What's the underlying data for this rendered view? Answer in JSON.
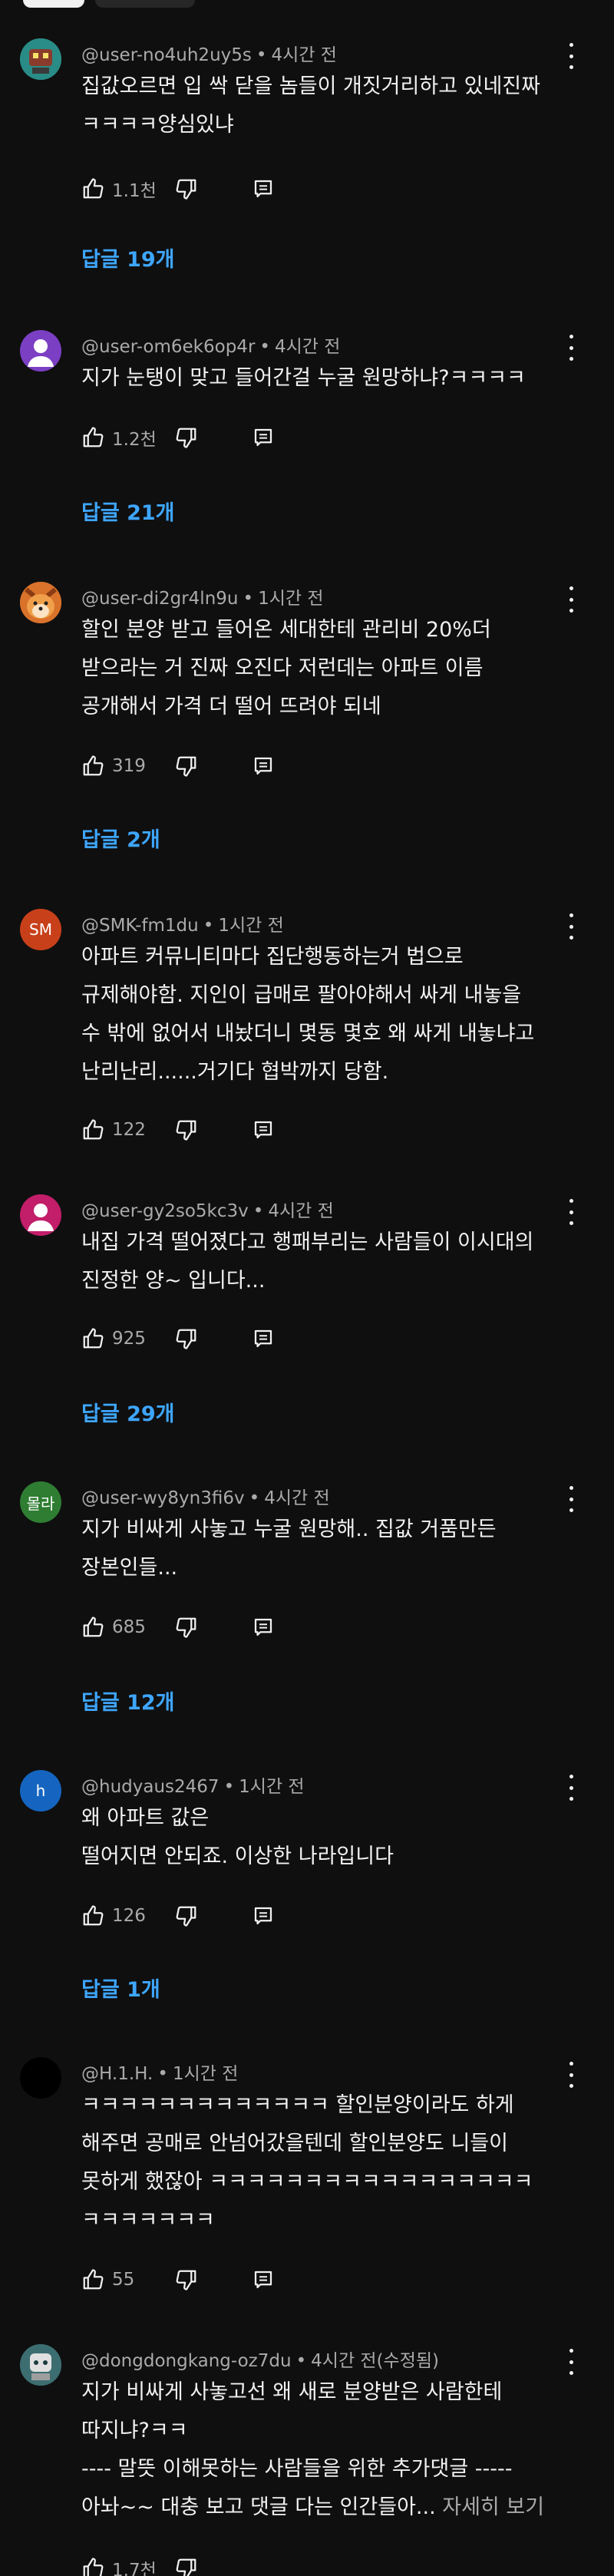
{
  "comments": [
    {
      "handle": "@user-no4uh2uy5s",
      "time": "4시간 전",
      "avatar": "",
      "text": "집값오르면 입 싹 닫을 놈들이 개짓거리하고 있네진짜\nㅋㅋㅋㅋ양심있냐",
      "more": "",
      "likes": "1.1천",
      "replies": "답글 19개",
      "colors": {
        "avatar_bg": "#2a8c86"
      }
    },
    {
      "handle": "@user-om6ek6op4r",
      "time": "4시간 전",
      "avatar": "",
      "text": "지가 눈탱이 맞고 들어간걸 누굴 원망하냐?ㅋㅋㅋㅋ",
      "more": "",
      "likes": "1.2천",
      "replies": "답글 21개",
      "colors": {
        "avatar_bg": "#7b3fc4"
      }
    },
    {
      "handle": "@user-di2gr4ln9u",
      "time": "1시간 전",
      "avatar": "",
      "text": "할인 분양 받고 들어온 세대한테 관리비 20%더\n받으라는 거  진짜 오진다    저런데는 아파트 이름\n공개해서 가격 더 떨어 뜨려야 되네",
      "more": "",
      "likes": "319",
      "replies": "답글 2개",
      "colors": {
        "avatar_bg": "#d9722b"
      }
    },
    {
      "handle": "@SMK-fm1du",
      "time": "1시간 전",
      "avatar": "SM",
      "text": "아파트 커뮤니티마다 집단행동하는거 법으로\n규제해야함. 지인이 급매로 팔아야해서 싸게 내놓을\n수 밖에 없어서 내놨더니 몇동 몇호 왜 싸게 내놓냐고\n난리난리......거기다 협박까지 당함.",
      "more": "",
      "likes": "122",
      "replies": "",
      "colors": {
        "avatar_bg": "#c8401a"
      }
    },
    {
      "handle": "@user-gy2so5kc3v",
      "time": "4시간 전",
      "avatar": "",
      "text": "내집 가격 떨어졌다고 행패부리는 사람들이 이시대의\n진정한 양~ 입니다...",
      "more": "",
      "likes": "925",
      "replies": "답글 29개",
      "colors": {
        "avatar_bg": "#c21e6a"
      }
    },
    {
      "handle": "@user-wy8yn3fi6v",
      "time": "4시간 전",
      "avatar": "몰라",
      "text": "지가 비싸게 사놓고 누굴 원망해.. 집값 거품만든\n장본인들...",
      "more": "",
      "likes": "685",
      "replies": "답글 12개",
      "colors": {
        "avatar_bg": "#2e7d32"
      }
    },
    {
      "handle": "@hudyaus2467",
      "time": "1시간 전",
      "avatar": "h",
      "text": "왜 아파트 값은\n떨어지면 안되죠.  이상한 나라입니다",
      "more": "",
      "likes": "126",
      "replies": "답글 1개",
      "colors": {
        "avatar_bg": "#1565c0"
      }
    },
    {
      "handle": "@H.1.H.",
      "time": "1시간 전",
      "avatar": "",
      "text": "ㅋㅋㅋㅋㅋㅋㅋㅋㅋㅋㅋㅋㅋ 할인분양이라도 하게\n해주면 공매로 안넘어갔을텐데 할인분양도 니들이\n못하게 했잖아 ㅋㅋㅋㅋㅋㅋㅋㅋㅋㅋㅋㅋㅋㅋㅋㅋㅋ\nㅋㅋㅋㅋㅋㅋㅋ",
      "more": "",
      "likes": "55",
      "replies": "",
      "colors": {
        "avatar_bg": "#000000"
      }
    },
    {
      "handle": "@dongdongkang-oz7du",
      "time": "4시간 전(수정됨)",
      "avatar": "",
      "text": "지가 비싸게 사놓고선 왜 새로 분양받은 사람한테\n따지냐?ㅋㅋ\n---- 말뜻 이해못하는 사람들을 위한 추가댓글  -----\n아놔~~ 대충 보고 댓글 다는 인간들아... ",
      "more": "자세히 보기",
      "likes": "1.7천",
      "replies": "",
      "colors": {
        "avatar_bg": "#3c6e71"
      }
    }
  ]
}
